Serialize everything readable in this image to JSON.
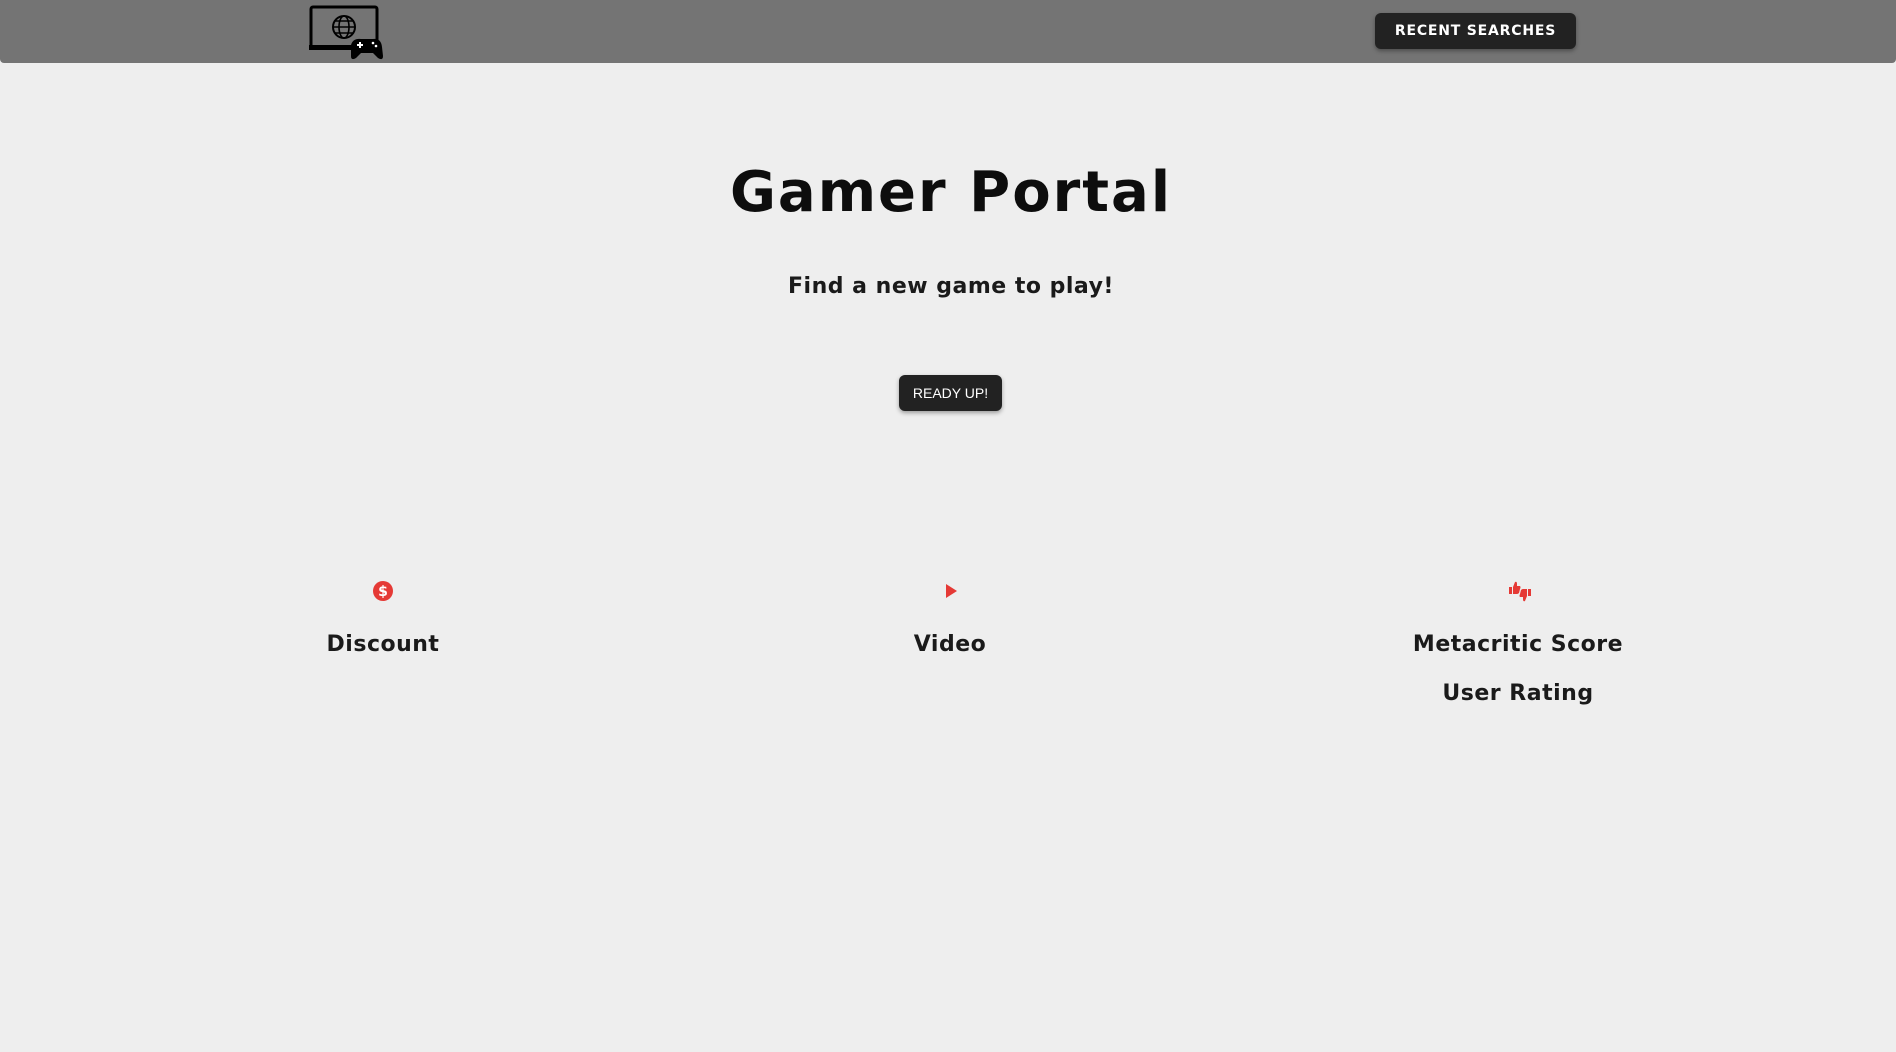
{
  "nav": {
    "logo_icon": "monitor-globe-controller-icon",
    "recent_label": "RECENT SEARCHES"
  },
  "hero": {
    "title": "Gamer Portal",
    "subtitle": "Find a new game to play!",
    "cta_label": "READY UP!"
  },
  "features": {
    "accent_color": "#e53935",
    "discount": {
      "icon": "dollar-circle-icon",
      "label": "Discount"
    },
    "video": {
      "icon": "play-icon",
      "label": "Video"
    },
    "rating": {
      "icon": "thumbs-up-down-icon",
      "labels": [
        "Metacritic Score",
        "User Rating"
      ]
    }
  },
  "colors": {
    "navbar": "#747474",
    "background": "#eeeeee",
    "button": "#222222",
    "accent": "#e53935"
  }
}
